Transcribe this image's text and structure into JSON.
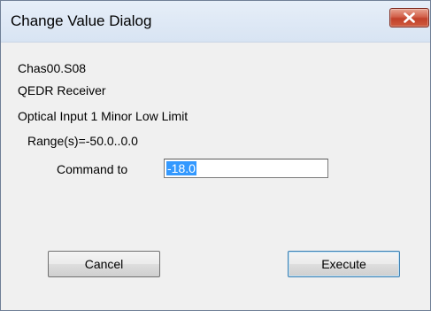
{
  "window": {
    "title": "Change Value Dialog"
  },
  "info": {
    "chassis": "Chas00.S08",
    "receiver": "QEDR Receiver",
    "parameter": "Optical Input 1 Minor Low Limit",
    "range": "Range(s)=-50.0..0.0"
  },
  "command": {
    "label": "Command to",
    "value": "-18.0"
  },
  "buttons": {
    "cancel_label": "Cancel",
    "execute_label": "Execute"
  },
  "icons": {
    "close": "close-icon"
  },
  "colors": {
    "close_button": "#c74a32",
    "selection": "#3399ff",
    "default_button_border": "#3c7fb1"
  }
}
